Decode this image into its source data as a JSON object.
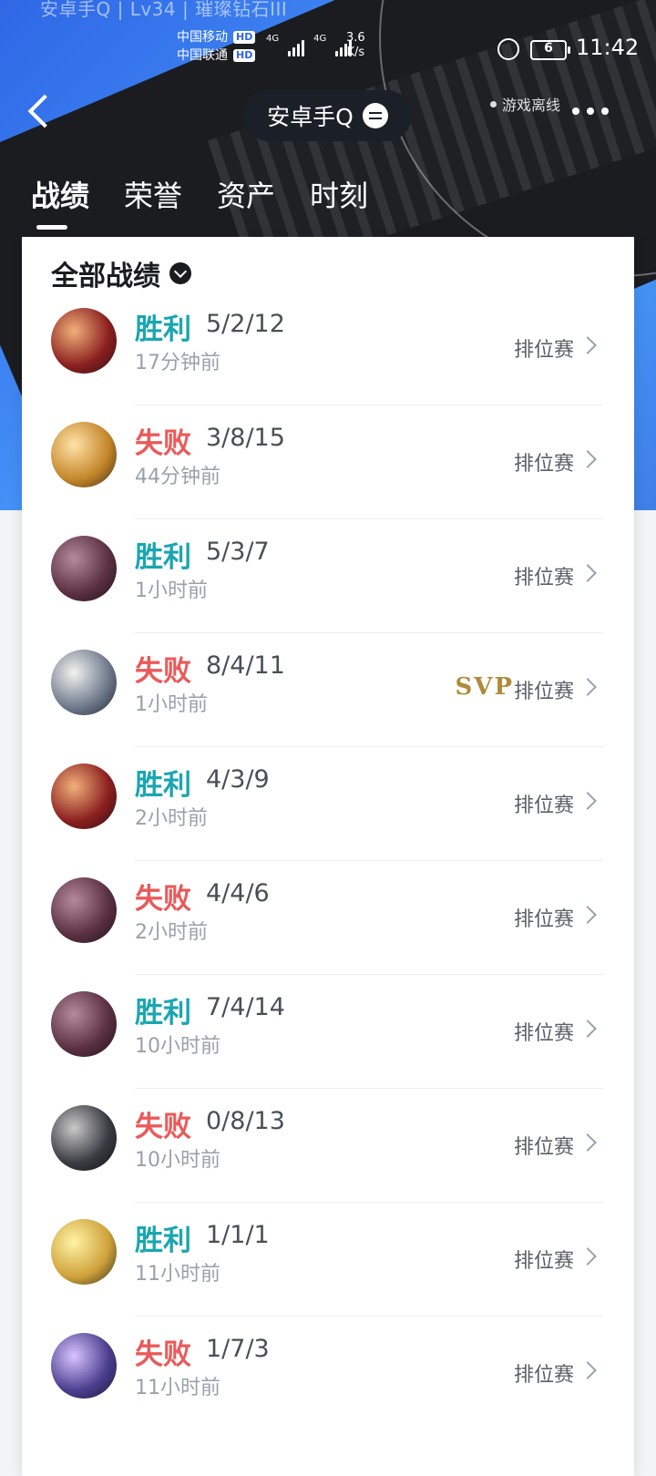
{
  "app": {
    "top_overlay_text": "安卓手Q | Lv34 | 璀璨钻石III",
    "status_bar": {
      "carrier_1": "中国移动",
      "carrier_2": "中国联通",
      "hd_label": "HD",
      "net_label": "4G",
      "net_speed_value": "3.6",
      "net_speed_unit": "K/s",
      "battery_level": "6",
      "time": "11:42"
    },
    "header": {
      "title": "安卓手Q",
      "presence": "游戏离线"
    },
    "tabs": [
      "战绩",
      "荣誉",
      "资产",
      "时刻"
    ],
    "section_title": "全部战绩",
    "records": [
      {
        "result": "胜利",
        "outcome": "win",
        "kda": "5/2/12",
        "ago": "17分钟前",
        "mode": "排位赛",
        "avatar": {
          "a": "#f1b07a",
          "b": "#8b1f1f",
          "c": "#2b1014"
        }
      },
      {
        "result": "失败",
        "outcome": "lose",
        "kda": "3/8/15",
        "ago": "44分钟前",
        "mode": "排位赛",
        "avatar": {
          "a": "#ffe2a8",
          "b": "#c4862a",
          "c": "#3b2a19"
        }
      },
      {
        "result": "胜利",
        "outcome": "win",
        "kda": "5/3/7",
        "ago": "1小时前",
        "mode": "排位赛",
        "avatar": {
          "a": "#b58a9c",
          "b": "#5a3040",
          "c": "#1f1117"
        }
      },
      {
        "result": "失败",
        "outcome": "lose",
        "kda": "8/4/11",
        "ago": "1小时前",
        "mode": "排位赛",
        "svp": "SVP",
        "avatar": {
          "a": "#f3f2f0",
          "b": "#6f7a8c",
          "c": "#1d2430"
        }
      },
      {
        "result": "胜利",
        "outcome": "win",
        "kda": "4/3/9",
        "ago": "2小时前",
        "mode": "排位赛",
        "avatar": {
          "a": "#f1b07a",
          "b": "#8b1f1f",
          "c": "#2b1014"
        }
      },
      {
        "result": "失败",
        "outcome": "lose",
        "kda": "4/4/6",
        "ago": "2小时前",
        "mode": "排位赛",
        "avatar": {
          "a": "#b58a9c",
          "b": "#5a3040",
          "c": "#1f1117"
        }
      },
      {
        "result": "胜利",
        "outcome": "win",
        "kda": "7/4/14",
        "ago": "10小时前",
        "mode": "排位赛",
        "avatar": {
          "a": "#b58a9c",
          "b": "#5a3040",
          "c": "#1f1117"
        }
      },
      {
        "result": "失败",
        "outcome": "lose",
        "kda": "0/8/13",
        "ago": "10小时前",
        "mode": "排位赛",
        "avatar": {
          "a": "#c9c9c9",
          "b": "#3a3b42",
          "c": "#0f1014"
        }
      },
      {
        "result": "胜利",
        "outcome": "win",
        "kda": "1/1/1",
        "ago": "11小时前",
        "mode": "排位赛",
        "avatar": {
          "a": "#fff3a6",
          "b": "#d0a23b",
          "c": "#2c2a1b"
        }
      },
      {
        "result": "失败",
        "outcome": "lose",
        "kda": "1/7/3",
        "ago": "11小时前",
        "mode": "排位赛",
        "avatar": {
          "a": "#d8c3ff",
          "b": "#4a3e8e",
          "c": "#1a1633"
        }
      }
    ]
  }
}
